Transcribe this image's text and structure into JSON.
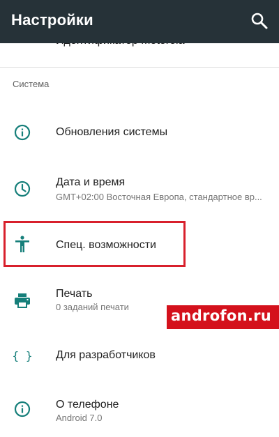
{
  "appbar": {
    "title": "Настройки",
    "search_icon": "search-icon"
  },
  "partial_item": {
    "label": "Идентификатор Motorola"
  },
  "section": {
    "title": "Система"
  },
  "items": [
    {
      "icon": "info-icon",
      "label": "Обновления системы"
    },
    {
      "icon": "clock-icon",
      "label": "Дата и время",
      "subtitle": "GMT+02:00 Восточная Европа, стандартное вр..."
    },
    {
      "icon": "accessibility-icon",
      "label": "Спец. возможности"
    },
    {
      "icon": "printer-icon",
      "label": "Печать",
      "subtitle": "0 заданий печати"
    },
    {
      "icon": "braces-icon",
      "label": "Для разработчиков"
    },
    {
      "icon": "info-icon",
      "label": "О телефоне",
      "subtitle": "Android 7.0"
    }
  ],
  "watermark": {
    "text": "androfon.ru"
  },
  "colors": {
    "appbar": "#263238",
    "accent": "#167f7a",
    "highlight": "#d8202c",
    "watermark_bg": "#d4111c"
  }
}
